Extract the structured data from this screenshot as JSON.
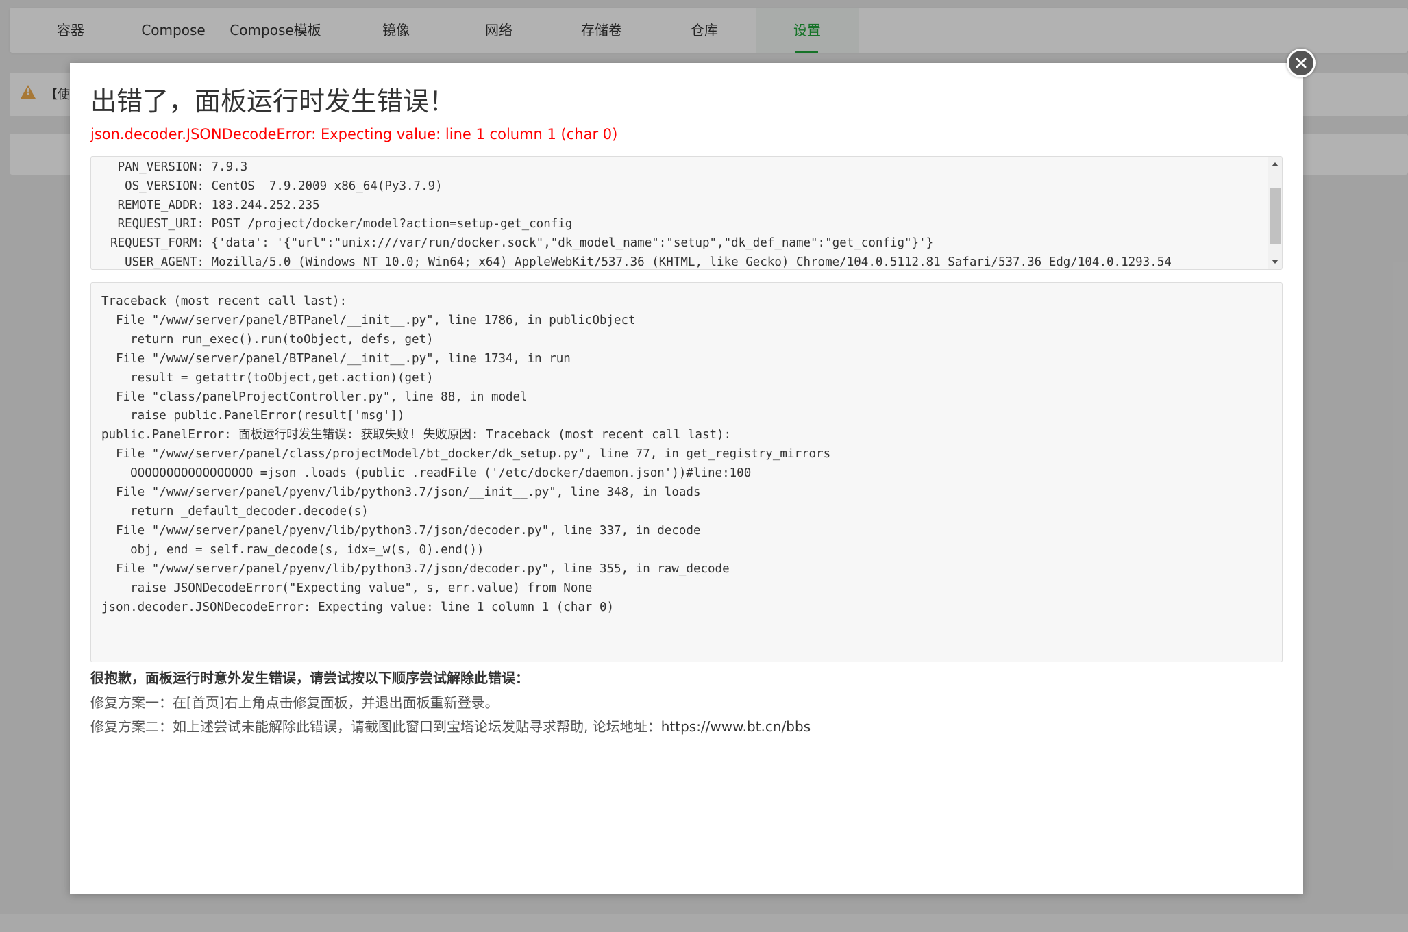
{
  "tabs": [
    {
      "label": "容器",
      "active": false
    },
    {
      "label": "Compose",
      "active": false
    },
    {
      "label": "Compose模板",
      "active": false
    },
    {
      "label": "镜像",
      "active": false
    },
    {
      "label": "网络",
      "active": false
    },
    {
      "label": "存储卷",
      "active": false
    },
    {
      "label": "仓库",
      "active": false
    },
    {
      "label": "设置",
      "active": true
    }
  ],
  "alert": {
    "icon": "warning-icon",
    "text": "【使"
  },
  "modal": {
    "close_icon": "close-icon",
    "title": "出错了，面板运行时发生错误！",
    "subtitle": "json.decoder.JSONDecodeError: Expecting value: line 1 column 1 (char 0)",
    "env": [
      {
        "key": "PAN_VERSION:",
        "value": "7.9.3"
      },
      {
        "key": "OS_VERSION:",
        "value": "CentOS  7.9.2009 x86_64(Py3.7.9)"
      },
      {
        "key": "REMOTE_ADDR:",
        "value": "183.244.252.235"
      },
      {
        "key": "REQUEST_URI:",
        "value": "POST /project/docker/model?action=setup-get_config"
      },
      {
        "key": "REQUEST_FORM:",
        "value": "{'data': '{\"url\":\"unix:///var/run/docker.sock\",\"dk_model_name\":\"setup\",\"dk_def_name\":\"get_config\"}'}"
      },
      {
        "key": "USER_AGENT:",
        "value": "Mozilla/5.0 (Windows NT 10.0; Win64; x64) AppleWebKit/537.36 (KHTML, like Gecko) Chrome/104.0.5112.81 Safari/537.36 Edg/104.0.1293.54"
      }
    ],
    "traceback": "Traceback (most recent call last):\n  File \"/www/server/panel/BTPanel/__init__.py\", line 1786, in publicObject\n    return run_exec().run(toObject, defs, get)\n  File \"/www/server/panel/BTPanel/__init__.py\", line 1734, in run\n    result = getattr(toObject,get.action)(get)\n  File \"class/panelProjectController.py\", line 88, in model\n    raise public.PanelError(result['msg'])\npublic.PanelError: 面板运行时发生错误: 获取失败! 失败原因: Traceback (most recent call last):\n  File \"/www/server/panel/class/projectModel/bt_docker/dk_setup.py\", line 77, in get_registry_mirrors\n    OOOOOOOOOOOOOOOOO =json .loads (public .readFile ('/etc/docker/daemon.json'))#line:100\n  File \"/www/server/panel/pyenv/lib/python3.7/json/__init__.py\", line 348, in loads\n    return _default_decoder.decode(s)\n  File \"/www/server/panel/pyenv/lib/python3.7/json/decoder.py\", line 337, in decode\n    obj, end = self.raw_decode(s, idx=_w(s, 0).end())\n  File \"/www/server/panel/pyenv/lib/python3.7/json/decoder.py\", line 355, in raw_decode\n    raise JSONDecodeError(\"Expecting value\", s, err.value) from None\njson.decoder.JSONDecodeError: Expecting value: line 1 column 1 (char 0)",
    "help_heading": "很抱歉，面板运行时意外发生错误，请尝试按以下顺序尝试解除此错误：",
    "help_line1": "修复方案一：在[首页]右上角点击修复面板，并退出面板重新登录。",
    "help_line2_prefix": "修复方案二：如上述尝试未能解除此错误，请截图此窗口到宝塔论坛发贴寻求帮助, 论坛地址：",
    "help_link": "https://www.bt.cn/bbs"
  },
  "colors": {
    "accent": "#20a53a",
    "error": "#ff0000",
    "warning": "#f0ad4e"
  }
}
